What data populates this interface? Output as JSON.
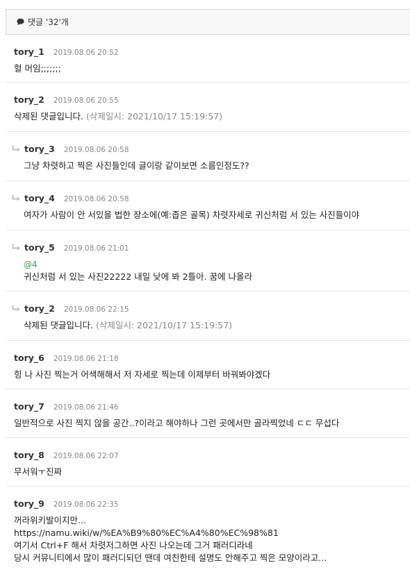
{
  "header": {
    "label": "댓글 '32'개"
  },
  "comments": [
    {
      "author": "tory_1",
      "date": "2019.08.06 20:52",
      "text": "헐 머임;;;;;;;"
    },
    {
      "author": "tory_2",
      "date": "2019.08.06 20:55",
      "text": "삭제된 댓글입니다.",
      "note": "(삭제일시: 2021/10/17 15:19:57)"
    },
    {
      "author": "tory_3",
      "date": "2019.08.06 20:58",
      "text": "그냥 차렷하고 찍은 사진들인데 글이랑 같이보면 소름인정도??"
    },
    {
      "author": "tory_4",
      "date": "2019.08.06 20:58",
      "text": "여자가 사람이 안 서있을 법한 장소에(예:좁은 골목) 차렷자세로 귀신처럼 서 있는 사진들이야"
    },
    {
      "author": "tory_5",
      "date": "2019.08.06 21:01",
      "mention": "@4",
      "text": "귀신처럼 서 있는 사진22222 내일 낮에 봐 2틀아. 꿈에 나올라"
    },
    {
      "author": "tory_2",
      "date": "2019.08.06 22:15",
      "text": "삭제된 댓글입니다.",
      "note": "(삭제일시: 2021/10/17 15:19:57)"
    },
    {
      "author": "tory_6",
      "date": "2019.08.06 21:18",
      "text": "힝 나 사진 찍는거 어색해해서 저 자세로 찍는데 이제부터 바꿔봐야겠다"
    },
    {
      "author": "tory_7",
      "date": "2019.08.06 21:46",
      "text": "일반적으로 사진 찍지 않을 공간..?이라고 해야하나 그런 곳에서만 골라찍었네 ㄷㄷ 무섭다"
    },
    {
      "author": "tory_8",
      "date": "2019.08.06 22:07",
      "text": "무서워ㅜ진짜"
    },
    {
      "author": "tory_9",
      "date": "2019.08.06 22:35",
      "lines": [
        "꺼라위키발이지만...",
        "https://namu.wiki/w/%EA%B9%80%EC%A4%80%EC%98%81",
        "여기서 Ctrl+F 해서 차렷저그하면 사진 나오는데 그거 패러디라네",
        "당시 커뮤니티에서 많이 패러디되던 땐데 여친한테 설명도 안해주고 찍은 모양이라고..."
      ]
    }
  ]
}
